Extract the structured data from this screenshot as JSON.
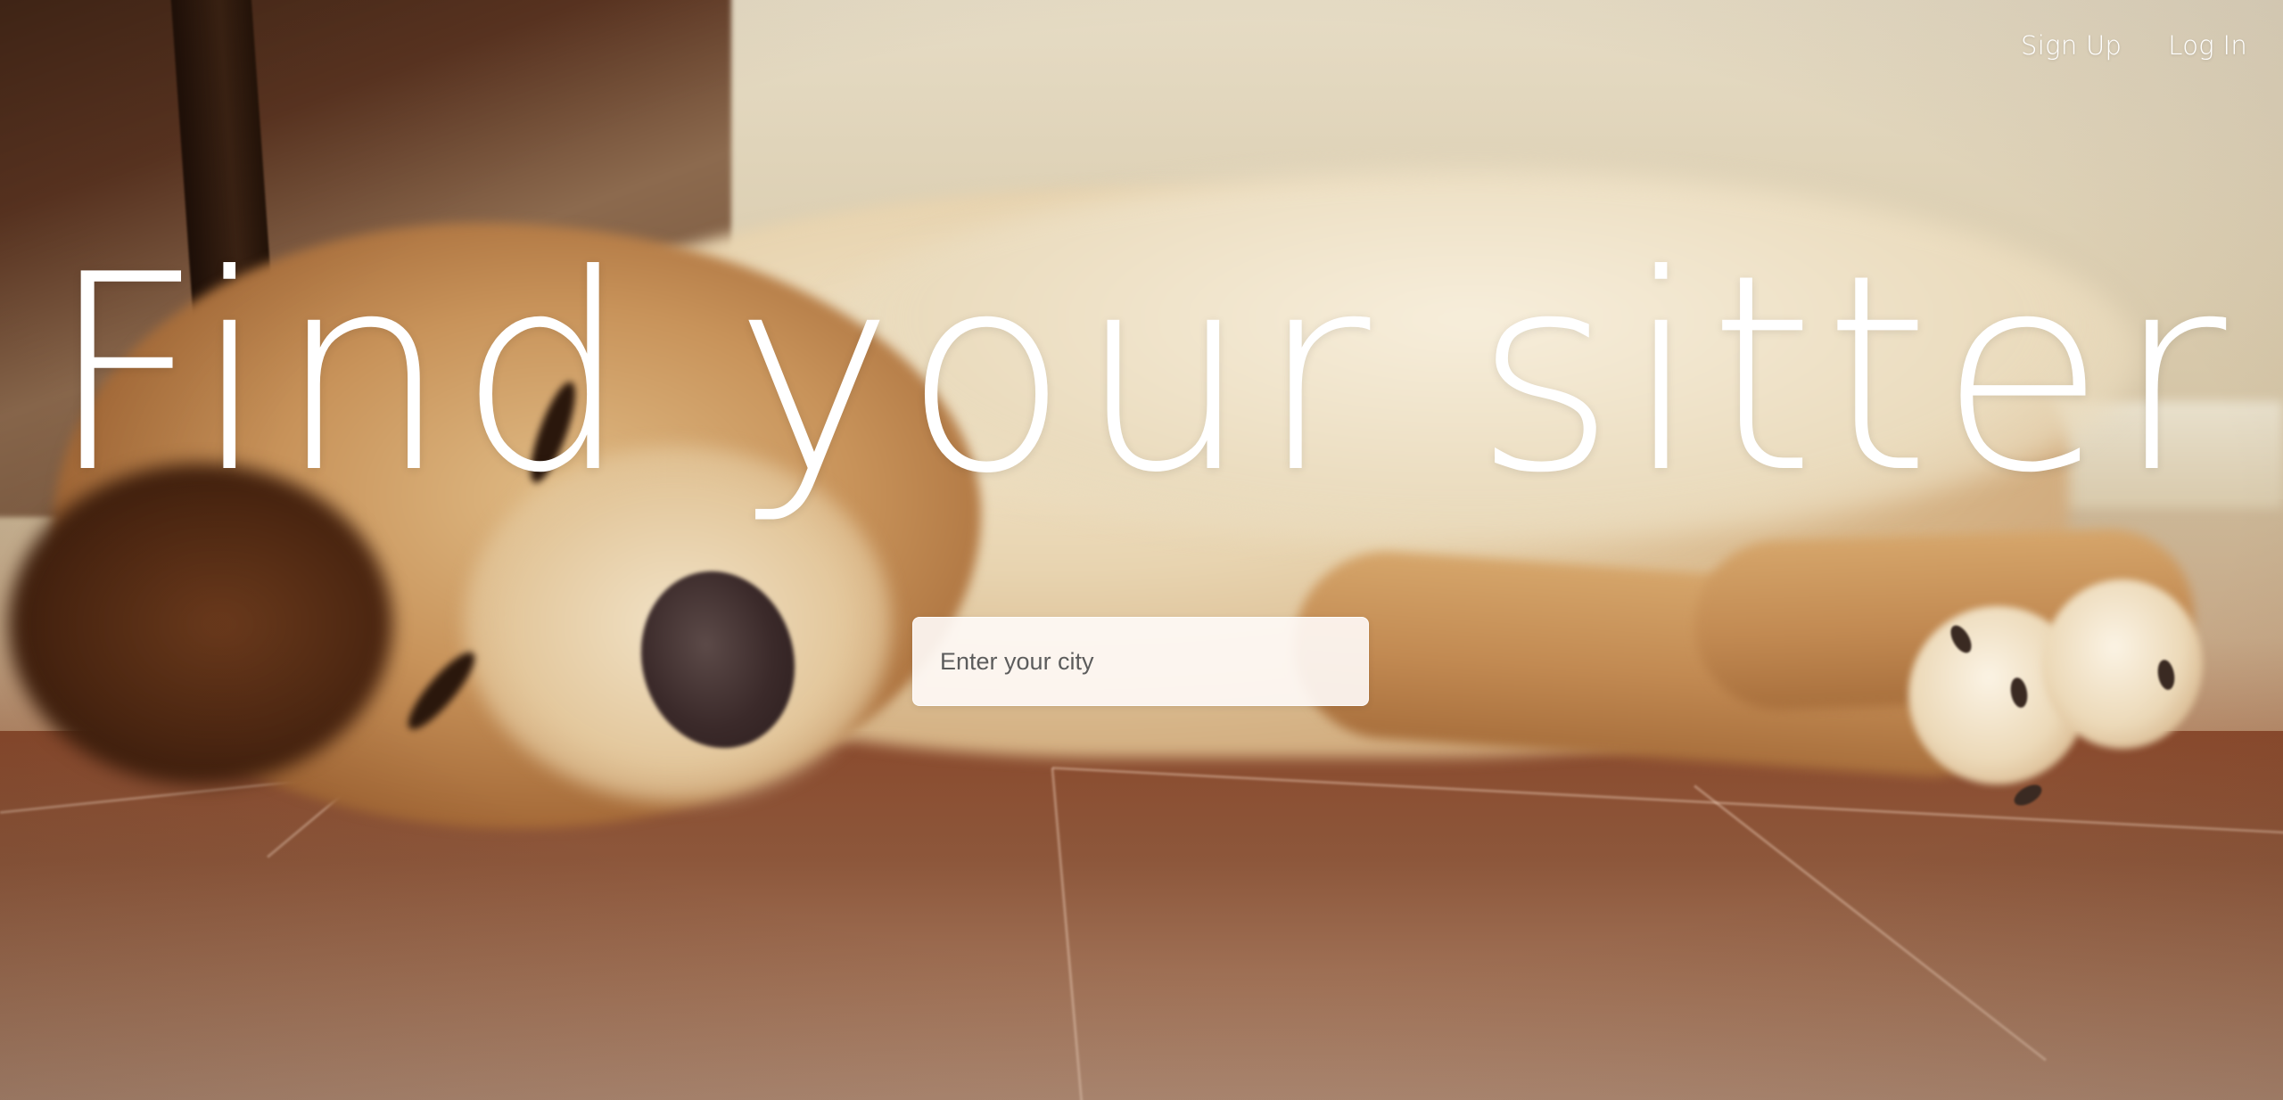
{
  "nav": {
    "signup_label": "Sign Up",
    "login_label": "Log In"
  },
  "hero": {
    "headline": "Find your sitter",
    "background": "photo of a golden retriever lying on a wooden floor"
  },
  "search": {
    "placeholder": "Enter your city",
    "value": ""
  }
}
